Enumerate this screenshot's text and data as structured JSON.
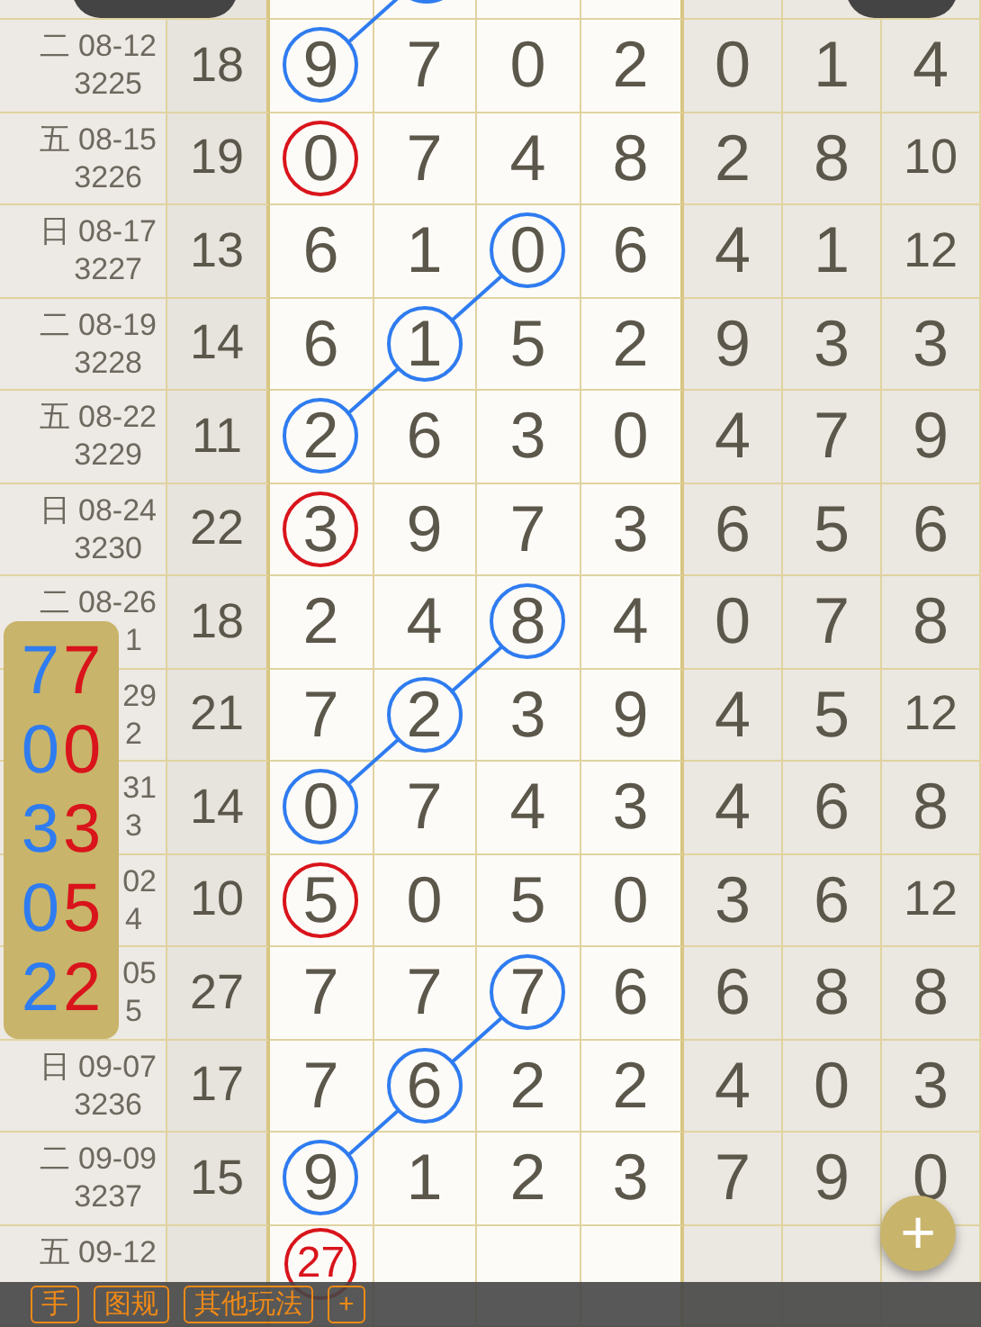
{
  "top_row": {
    "circled": [
      false,
      true,
      false,
      false
    ],
    "color": "#2f7cf0"
  },
  "rows": [
    {
      "week": "二",
      "date": "08-12",
      "issue": "3225",
      "sum": "18",
      "digits": [
        "9",
        "7",
        "0",
        "2"
      ],
      "circled": [
        true,
        false,
        false,
        false
      ],
      "extra": [
        "0",
        "1",
        "4"
      ],
      "color": "#2f7cf0"
    },
    {
      "week": "五",
      "date": "08-15",
      "issue": "3226",
      "sum": "19",
      "digits": [
        "0",
        "7",
        "4",
        "8"
      ],
      "circled": [
        true,
        false,
        false,
        false
      ],
      "extra": [
        "2",
        "8",
        "10"
      ],
      "color": "#d9141b"
    },
    {
      "week": "日",
      "date": "08-17",
      "issue": "3227",
      "sum": "13",
      "digits": [
        "6",
        "1",
        "0",
        "6"
      ],
      "circled": [
        false,
        false,
        true,
        false
      ],
      "extra": [
        "4",
        "1",
        "12"
      ],
      "color": "#2f7cf0"
    },
    {
      "week": "二",
      "date": "08-19",
      "issue": "3228",
      "sum": "14",
      "digits": [
        "6",
        "1",
        "5",
        "2"
      ],
      "circled": [
        false,
        true,
        false,
        false
      ],
      "extra": [
        "9",
        "3",
        "3"
      ],
      "color": "#2f7cf0"
    },
    {
      "week": "五",
      "date": "08-22",
      "issue": "3229",
      "sum": "11",
      "digits": [
        "2",
        "6",
        "3",
        "0"
      ],
      "circled": [
        true,
        false,
        false,
        false
      ],
      "extra": [
        "4",
        "7",
        "9"
      ],
      "color": "#2f7cf0"
    },
    {
      "week": "日",
      "date": "08-24",
      "issue": "3230",
      "sum": "22",
      "digits": [
        "3",
        "9",
        "7",
        "3"
      ],
      "circled": [
        true,
        false,
        false,
        false
      ],
      "extra": [
        "6",
        "5",
        "6"
      ],
      "color": "#d9141b"
    },
    {
      "week": "二",
      "date": "08-26",
      "issue": "1",
      "sum": "18",
      "digits": [
        "2",
        "4",
        "8",
        "4"
      ],
      "circled": [
        false,
        false,
        true,
        false
      ],
      "extra": [
        "0",
        "7",
        "8"
      ],
      "color": "#2f7cf0"
    },
    {
      "date": "29",
      "issue": "2",
      "sum": "21",
      "digits": [
        "7",
        "2",
        "3",
        "9"
      ],
      "circled": [
        false,
        true,
        false,
        false
      ],
      "extra": [
        "4",
        "5",
        "12"
      ],
      "color": "#2f7cf0"
    },
    {
      "date": "31",
      "issue": "3",
      "sum": "14",
      "digits": [
        "0",
        "7",
        "4",
        "3"
      ],
      "circled": [
        true,
        false,
        false,
        false
      ],
      "extra": [
        "4",
        "6",
        "8"
      ],
      "color": "#2f7cf0"
    },
    {
      "date": "02",
      "issue": "4",
      "sum": "10",
      "digits": [
        "5",
        "0",
        "5",
        "0"
      ],
      "circled": [
        true,
        false,
        false,
        false
      ],
      "extra": [
        "3",
        "6",
        "12"
      ],
      "color": "#d9141b"
    },
    {
      "date": "05",
      "issue": "5",
      "sum": "27",
      "digits": [
        "7",
        "7",
        "7",
        "6"
      ],
      "circled": [
        false,
        false,
        true,
        false
      ],
      "extra": [
        "6",
        "8",
        "8"
      ],
      "color": "#2f7cf0"
    },
    {
      "week": "日",
      "date": "09-07",
      "issue": "3236",
      "sum": "17",
      "digits": [
        "7",
        "6",
        "2",
        "2"
      ],
      "circled": [
        false,
        true,
        false,
        false
      ],
      "extra": [
        "4",
        "0",
        "3"
      ],
      "color": "#2f7cf0"
    },
    {
      "week": "二",
      "date": "09-09",
      "issue": "3237",
      "sum": "15",
      "digits": [
        "9",
        "1",
        "2",
        "3"
      ],
      "circled": [
        true,
        false,
        false,
        false
      ],
      "extra": [
        "7",
        "9",
        "0"
      ],
      "color": "#2f7cf0"
    },
    {
      "week": "五",
      "date": "09-12",
      "digits": [
        "27"
      ],
      "circled": [
        true
      ],
      "extra": [],
      "color": "#d9141b"
    }
  ],
  "overlay_panel": [
    {
      "blue": "7",
      "red": "7"
    },
    {
      "blue": "0",
      "red": "0"
    },
    {
      "blue": "3",
      "red": "3"
    },
    {
      "blue": "0",
      "red": "5"
    },
    {
      "blue": "2",
      "red": "2"
    }
  ],
  "fab": {
    "label": "+"
  },
  "toolbar": [
    "手",
    "图规",
    "其他玩法",
    "+"
  ]
}
